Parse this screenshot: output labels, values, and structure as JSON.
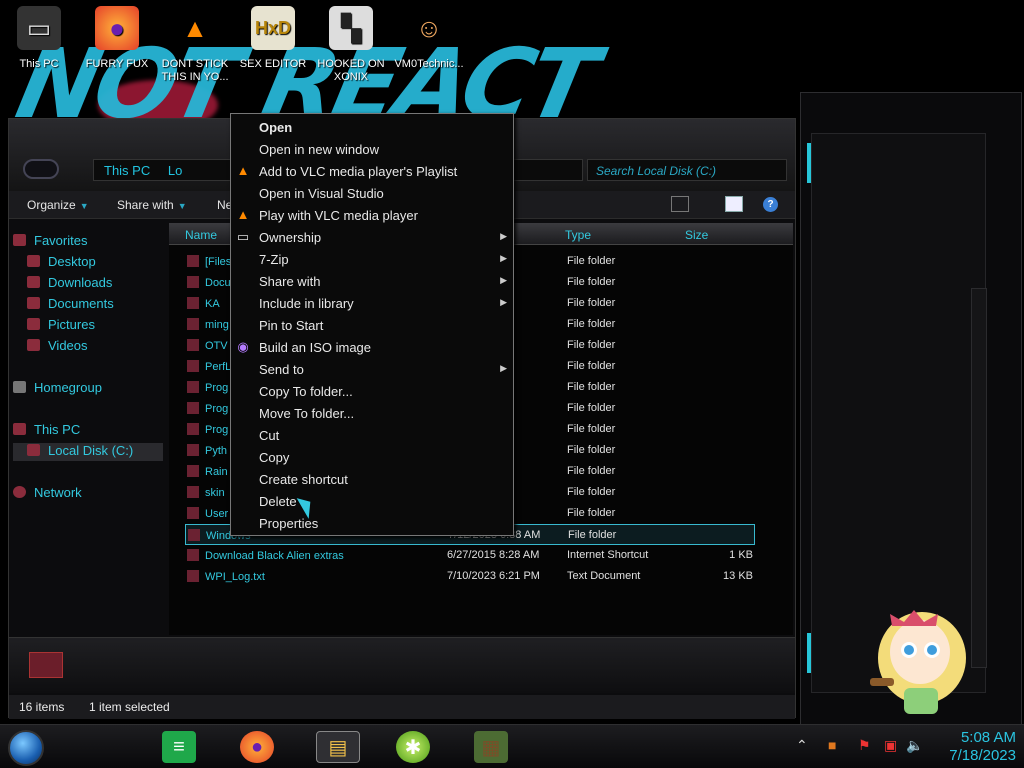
{
  "desktop_icons": [
    {
      "label": "This PC",
      "icon": "computer-icon"
    },
    {
      "label": "FURRY FUX",
      "icon": "firefox-icon"
    },
    {
      "label": "DONT STICK THIS IN YO...",
      "icon": "vlc-icon"
    },
    {
      "label": "SEX EDITOR",
      "icon": "hxd-icon"
    },
    {
      "label": "HOOKED ON XONIX",
      "icon": "game-icon"
    },
    {
      "label": "VM0Technic...",
      "icon": "person-icon"
    }
  ],
  "wallpaper_text": "NOT REACT",
  "explorer": {
    "breadcrumb": [
      "This PC",
      "Lo"
    ],
    "search_placeholder": "Search Local Disk (C:)",
    "toolbar": {
      "organize": "Organize",
      "share_with": "Share with",
      "new_folder": "Ne"
    },
    "columns": {
      "name": "Name",
      "type": "Type",
      "size": "Size"
    },
    "sidebar": {
      "favorites": "Favorites",
      "desktop": "Desktop",
      "downloads": "Downloads",
      "documents": "Documents",
      "pictures": "Pictures",
      "videos": "Videos",
      "homegroup": "Homegroup",
      "this_pc": "This PC",
      "local_disk": "Local Disk (C:)",
      "network": "Network"
    },
    "rows": [
      {
        "name": "[Files",
        "date": "5 PM",
        "type": "File folder",
        "size": ""
      },
      {
        "name": "Docu",
        "date": "5 AM",
        "type": "File folder",
        "size": ""
      },
      {
        "name": "KA",
        "date": "5 AM",
        "type": "File folder",
        "size": ""
      },
      {
        "name": "ming",
        "date": "3 AM",
        "type": "File folder",
        "size": ""
      },
      {
        "name": "OTV",
        "date": "4 AM",
        "type": "File folder",
        "size": ""
      },
      {
        "name": "PerfL",
        "date": "2 AM",
        "type": "File folder",
        "size": ""
      },
      {
        "name": "Prog",
        "date": "5 AM",
        "type": "File folder",
        "size": ""
      },
      {
        "name": "Prog",
        "date": "AM",
        "type": "File folder",
        "size": ""
      },
      {
        "name": "Prog",
        "date": "7 AM",
        "type": "File folder",
        "size": ""
      },
      {
        "name": "Pyth",
        "date": "9 AM",
        "type": "File folder",
        "size": ""
      },
      {
        "name": "Rain",
        "date": "9 AM",
        "type": "File folder",
        "size": ""
      },
      {
        "name": "skin",
        "date": "PM",
        "type": "File folder",
        "size": ""
      },
      {
        "name": "User",
        "date": "3 AM",
        "type": "File folder",
        "size": ""
      },
      {
        "name": "Windows",
        "date": "7/12/2023 6:38 AM",
        "type": "File folder",
        "size": ""
      },
      {
        "name": "Download Black Alien extras",
        "date": "6/27/2015 8:28 AM",
        "type": "Internet Shortcut",
        "size": "1 KB"
      },
      {
        "name": "WPI_Log.txt",
        "date": "7/10/2023 6:21 PM",
        "type": "Text Document",
        "size": "13 KB"
      }
    ],
    "status": {
      "items": "16 items",
      "selected": "1 item selected"
    }
  },
  "context_menu": [
    {
      "label": "Open",
      "bold": true,
      "icon": "",
      "submenu": false
    },
    {
      "label": "Open in new window",
      "icon": "",
      "submenu": false
    },
    {
      "label": "Add to VLC media player's Playlist",
      "icon": "vlc-icon",
      "submenu": false
    },
    {
      "label": "Open in Visual Studio",
      "icon": "",
      "submenu": false
    },
    {
      "label": "Play with VLC media player",
      "icon": "vlc-icon",
      "submenu": false
    },
    {
      "label": "Ownership",
      "icon": "cmd-icon",
      "submenu": true
    },
    {
      "label": "7-Zip",
      "icon": "",
      "submenu": true
    },
    {
      "label": "Share with",
      "icon": "",
      "submenu": true
    },
    {
      "label": "Include in library",
      "icon": "",
      "submenu": true
    },
    {
      "label": "Pin to Start",
      "icon": "",
      "submenu": false
    },
    {
      "label": "Build an ISO image",
      "icon": "disc-icon",
      "submenu": false
    },
    {
      "label": "Send to",
      "icon": "",
      "submenu": true
    },
    {
      "label": "Copy To folder...",
      "icon": "",
      "submenu": false
    },
    {
      "label": "Move To folder...",
      "icon": "",
      "submenu": false
    },
    {
      "label": "Cut",
      "icon": "",
      "submenu": false
    },
    {
      "label": "Copy",
      "icon": "",
      "submenu": false
    },
    {
      "label": "Create shortcut",
      "icon": "",
      "submenu": false
    },
    {
      "label": "Delete",
      "icon": "",
      "submenu": false
    },
    {
      "label": "Properties",
      "icon": "",
      "submenu": false
    }
  ],
  "taskbar": {
    "apps": [
      "notes-app-icon",
      "firefox-icon",
      "explorer-icon",
      "lime-app-icon",
      "minecraft-icon"
    ],
    "clock": {
      "time": "5:08 AM",
      "date": "7/18/2023"
    }
  }
}
